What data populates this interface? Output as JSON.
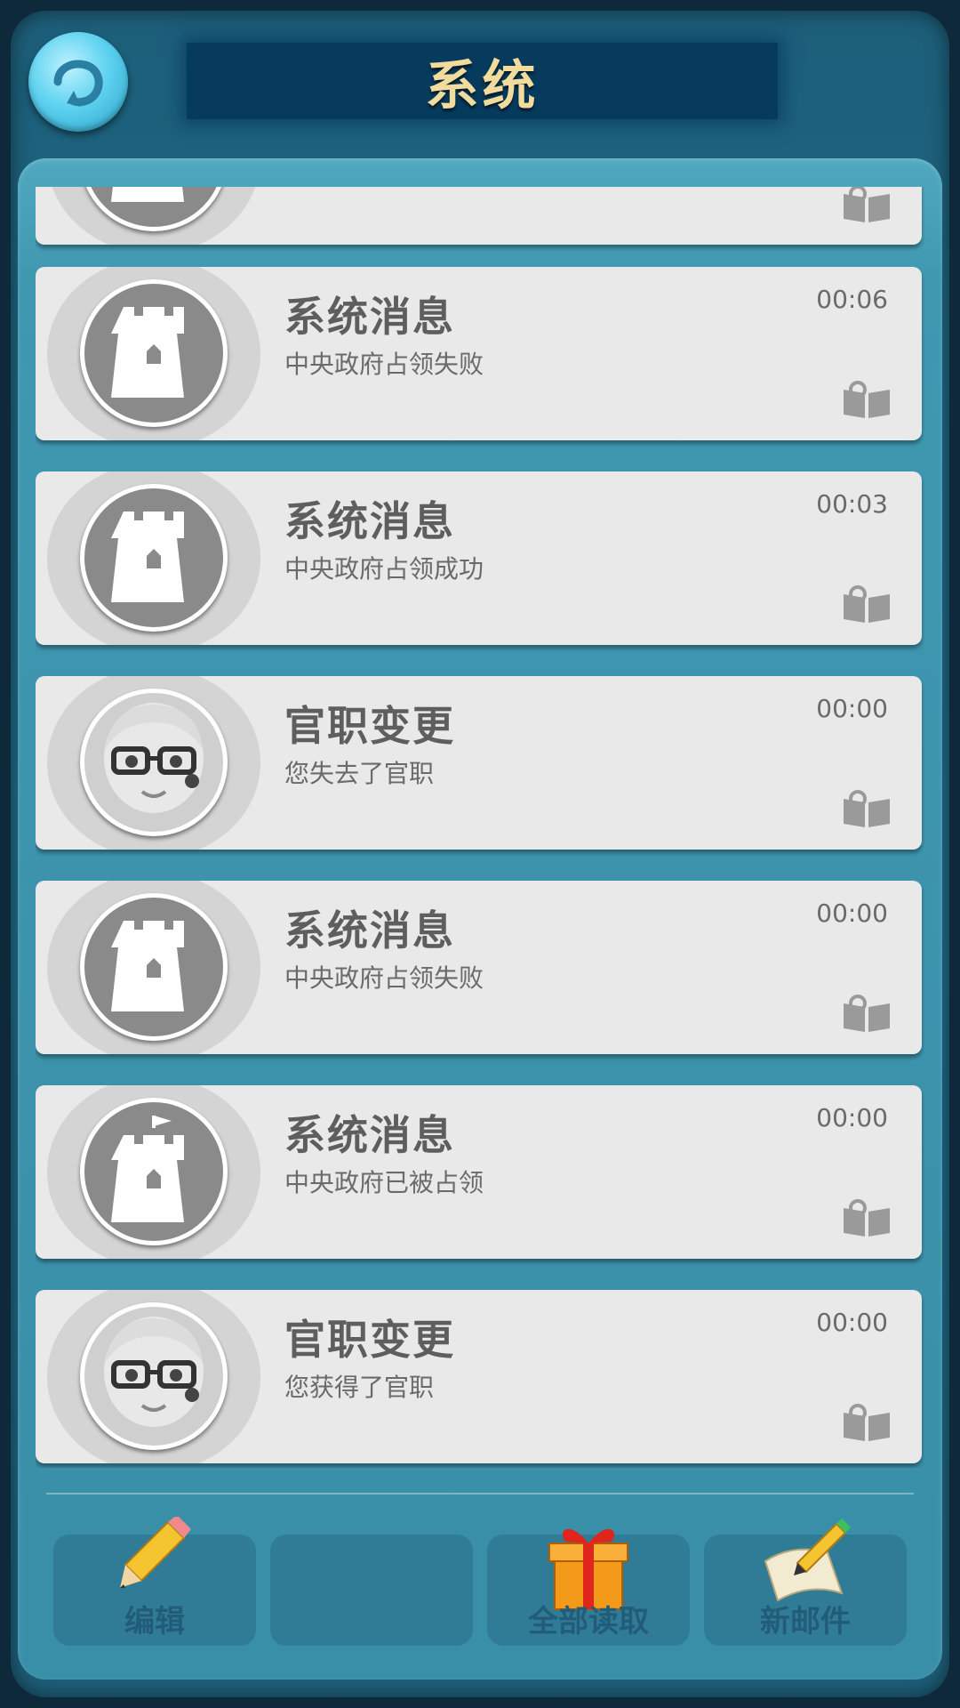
{
  "header": {
    "title": "系统"
  },
  "messages": [
    {
      "type": "tower",
      "title": "",
      "subtitle": "",
      "time": ""
    },
    {
      "type": "tower",
      "title": "系统消息",
      "subtitle": "中央政府占领失败",
      "time": "00:06"
    },
    {
      "type": "tower",
      "title": "系统消息",
      "subtitle": "中央政府占领成功",
      "time": "00:03"
    },
    {
      "type": "person",
      "title": "官职变更",
      "subtitle": "您失去了官职",
      "time": "00:00"
    },
    {
      "type": "tower",
      "title": "系统消息",
      "subtitle": "中央政府占领失败",
      "time": "00:00"
    },
    {
      "type": "tower-flag",
      "title": "系统消息",
      "subtitle": "中央政府已被占领",
      "time": "00:00"
    },
    {
      "type": "person",
      "title": "官职变更",
      "subtitle": "您获得了官职",
      "time": "00:00"
    }
  ],
  "toolbar": {
    "edit_label": "编辑",
    "empty_label": "",
    "read_all_label": "全部读取",
    "new_mail_label": "新邮件"
  },
  "icons": {
    "back": "back-arrow-icon",
    "read": "open-book-icon",
    "edit": "pencil-icon",
    "read_all": "gift-box-icon",
    "new_mail": "scroll-quill-icon"
  }
}
